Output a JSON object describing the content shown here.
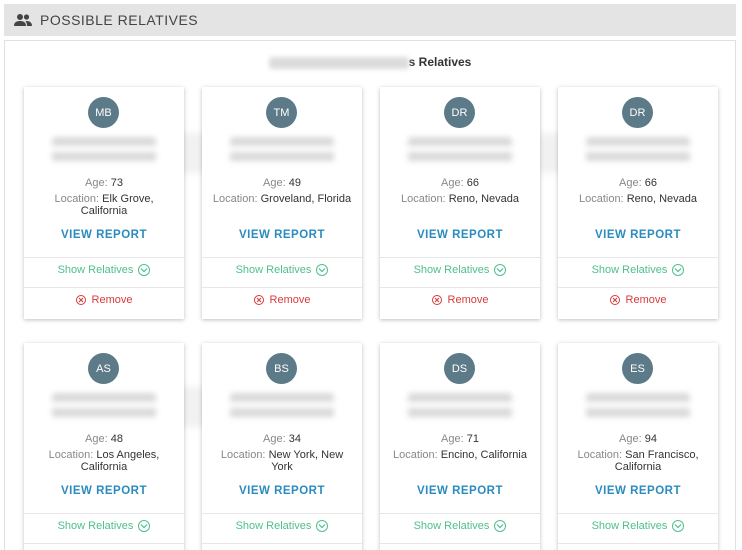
{
  "header": {
    "title": "POSSIBLE RELATIVES",
    "icon": "people-icon"
  },
  "panel": {
    "relatives_suffix": "s Relatives"
  },
  "card_labels": {
    "age": "Age:",
    "location": "Location:",
    "view_report": "VIEW REPORT",
    "show_relatives": "Show Relatives",
    "remove": "Remove"
  },
  "colors": {
    "avatar": "#5d7a89",
    "link": "#2a8bbf",
    "show_relatives": "#4fbf8f",
    "remove": "#d93a3a"
  },
  "relatives": [
    {
      "initials": "MB",
      "age": "73",
      "location_line1": "Elk Grove,",
      "location_line2": "California"
    },
    {
      "initials": "TM",
      "age": "49",
      "location_line1": "Groveland, Florida",
      "location_line2": ""
    },
    {
      "initials": "DR",
      "age": "66",
      "location_line1": "Reno, Nevada",
      "location_line2": ""
    },
    {
      "initials": "DR",
      "age": "66",
      "location_line1": "Reno, Nevada",
      "location_line2": ""
    },
    {
      "initials": "AS",
      "age": "48",
      "location_line1": "Los Angeles,",
      "location_line2": "California"
    },
    {
      "initials": "BS",
      "age": "34",
      "location_line1": "New York, New",
      "location_line2": "York"
    },
    {
      "initials": "DS",
      "age": "71",
      "location_line1": "Encino, California",
      "location_line2": ""
    },
    {
      "initials": "ES",
      "age": "94",
      "location_line1": "San Francisco,",
      "location_line2": "California"
    }
  ]
}
